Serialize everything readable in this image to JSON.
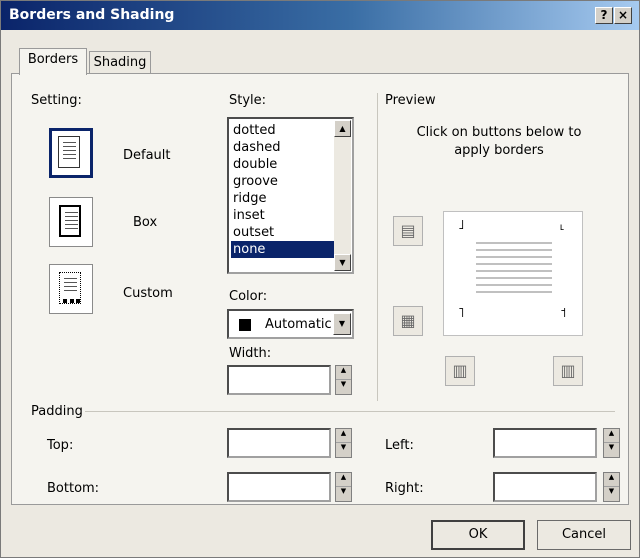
{
  "window": {
    "title": "Borders and Shading",
    "help_label": "?",
    "close_label": "×"
  },
  "tabs": [
    {
      "label": "Borders",
      "active": true
    },
    {
      "label": "Shading",
      "active": false
    }
  ],
  "setting": {
    "label": "Setting:",
    "options": [
      {
        "label": "Default",
        "selected": true
      },
      {
        "label": "Box",
        "selected": false
      },
      {
        "label": "Custom",
        "selected": false
      }
    ]
  },
  "style": {
    "label": "Style:",
    "items": [
      "dotted",
      "dashed",
      "double",
      "groove",
      "ridge",
      "inset",
      "outset",
      "none"
    ],
    "selected": "none",
    "scroll_up_icon": "triangle-up-icon",
    "scroll_down_icon": "triangle-down-icon"
  },
  "color": {
    "label": "Color:",
    "value": "Automatic",
    "swatch": "#000000"
  },
  "width": {
    "label": "Width:",
    "value": ""
  },
  "preview": {
    "label": "Preview",
    "hint": "Click on buttons below to apply borders",
    "buttons": [
      "top-border-icon",
      "bottom-border-icon",
      "left-border-icon",
      "right-border-icon"
    ]
  },
  "padding": {
    "label": "Padding",
    "top": {
      "label": "Top:",
      "value": ""
    },
    "bottom": {
      "label": "Bottom:",
      "value": ""
    },
    "left": {
      "label": "Left:",
      "value": ""
    },
    "right": {
      "label": "Right:",
      "value": ""
    }
  },
  "actions": {
    "ok": "OK",
    "cancel": "Cancel"
  },
  "colors": {
    "title_start": "#0a246a",
    "title_end": "#a6caf0",
    "selection": "#0a246a",
    "dialog_bg": "#ece9e1"
  }
}
